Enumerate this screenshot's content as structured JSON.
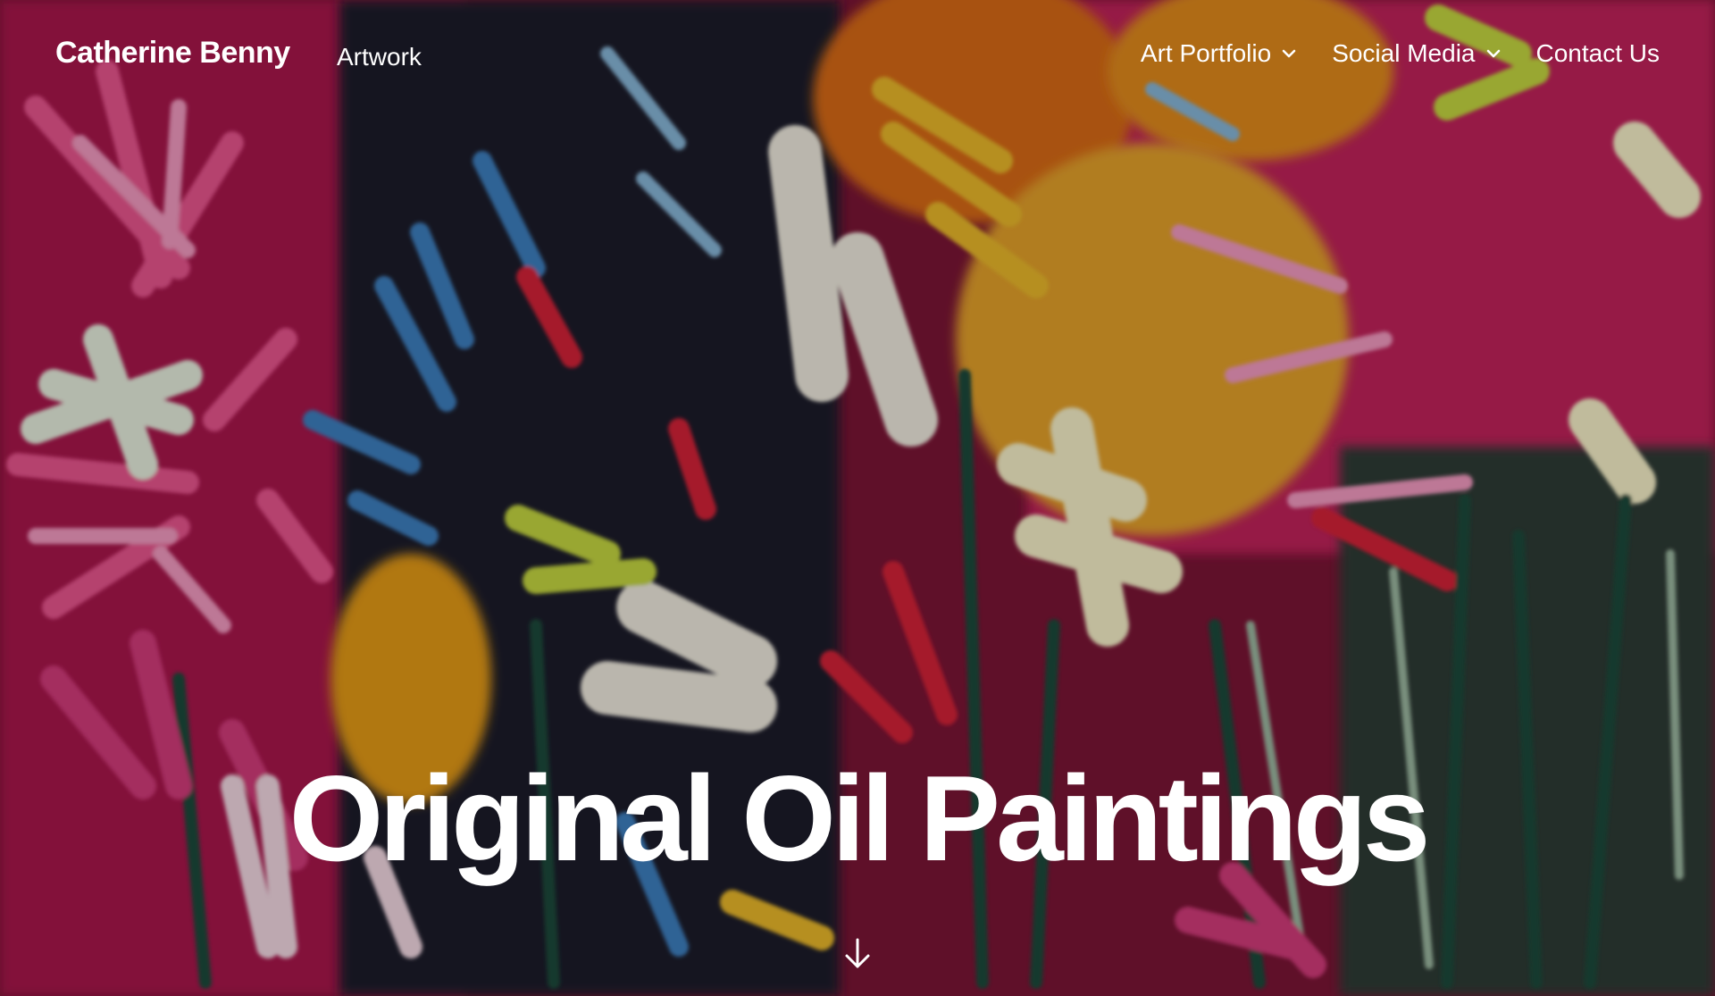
{
  "header": {
    "site_title": "Catherine Benny",
    "tagline": "Artwork"
  },
  "nav": {
    "items": [
      {
        "label": "Art Portfolio",
        "has_dropdown": true,
        "icon": "chevron-down-icon"
      },
      {
        "label": "Social Media",
        "has_dropdown": true,
        "icon": "chevron-down-icon"
      },
      {
        "label": "Contact Us",
        "has_dropdown": false
      }
    ]
  },
  "hero": {
    "title": "Original Oil Paintings",
    "scroll_icon": "arrow-down-icon",
    "background": "abstract floral oil painting"
  },
  "colors": {
    "text": "#ffffff",
    "magenta": "#c2185b",
    "pink": "#e87aa8",
    "blue": "#2a6fb0",
    "yellow": "#e8c020",
    "cream": "#f4efd6",
    "dark": "#1b1b1b"
  }
}
